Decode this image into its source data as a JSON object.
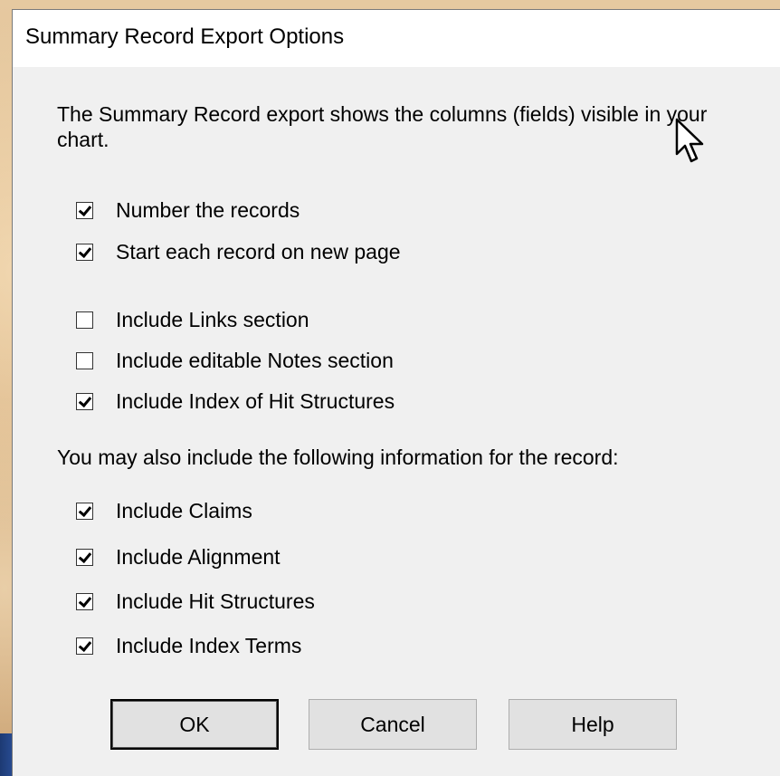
{
  "dialog": {
    "title": "Summary Record Export Options",
    "description": "The Summary Record export shows the columns (fields) visible in your chart.",
    "options_group1": [
      {
        "label": "Number the records",
        "checked": true
      },
      {
        "label": "Start each record on new page",
        "checked": true
      }
    ],
    "options_group2": [
      {
        "label": "Include Links section",
        "checked": false
      },
      {
        "label": "Include editable Notes section",
        "checked": false
      },
      {
        "label": "Include Index of Hit Structures",
        "checked": true
      }
    ],
    "info_heading": "You may also include the following information for the record:",
    "options_group3": [
      {
        "label": "Include Claims",
        "checked": true
      },
      {
        "label": "Include Alignment",
        "checked": true
      },
      {
        "label": "Include Hit Structures",
        "checked": true
      },
      {
        "label": "Include Index Terms",
        "checked": true
      }
    ],
    "buttons": {
      "ok": "OK",
      "cancel": "Cancel",
      "help": "Help"
    }
  }
}
